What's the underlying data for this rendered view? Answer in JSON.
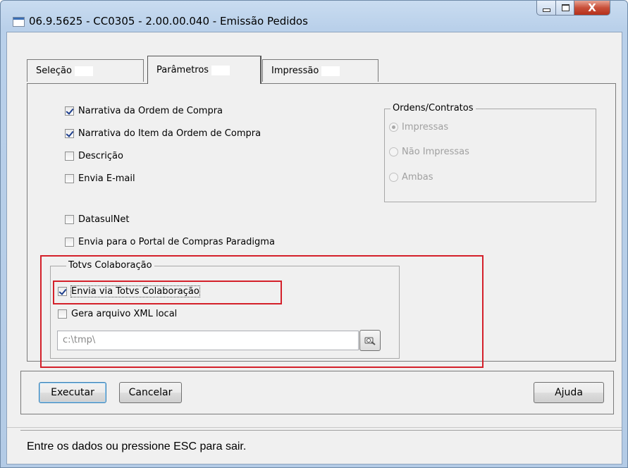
{
  "window": {
    "title": "06.9.5625 - CC0305 - 2.00.00.040 - Emissão Pedidos",
    "close_glyph": "X"
  },
  "tabs": [
    {
      "label": "Seleção"
    },
    {
      "label": "Parâmetros"
    },
    {
      "label": "Impressão"
    }
  ],
  "parametros": {
    "narrativa_ordem": {
      "label": "Narrativa da Ordem de Compra",
      "checked": true
    },
    "narrativa_item": {
      "label": "Narrativa do Item da Ordem de Compra",
      "checked": true
    },
    "descricao": {
      "label": "Descrição",
      "checked": false
    },
    "envia_email": {
      "label": "Envia E-mail",
      "checked": false
    },
    "datasulnet": {
      "label": "DatasulNet",
      "checked": false
    },
    "portal_paradigma": {
      "label": "Envia para o Portal de Compras Paradigma",
      "checked": false
    }
  },
  "ordens_contratos": {
    "title": "Ordens/Contratos",
    "options": [
      {
        "label": "Impressas",
        "selected": true
      },
      {
        "label": "Não Impressas",
        "selected": false
      },
      {
        "label": "Ambas",
        "selected": false
      }
    ]
  },
  "totvs": {
    "title": "Totvs Colaboração",
    "envia_via": {
      "label": "Envia via Totvs Colaboração",
      "checked": true
    },
    "gera_xml": {
      "label": "Gera arquivo XML local",
      "checked": false
    },
    "path_value": "c:\\tmp\\"
  },
  "buttons": {
    "executar": "Executar",
    "cancelar": "Cancelar",
    "ajuda": "Ajuda"
  },
  "status": "Entre os dados ou pressione ESC para sair.",
  "colors": {
    "highlight": "#d4202a",
    "check_mark": "#1d3e8c"
  }
}
